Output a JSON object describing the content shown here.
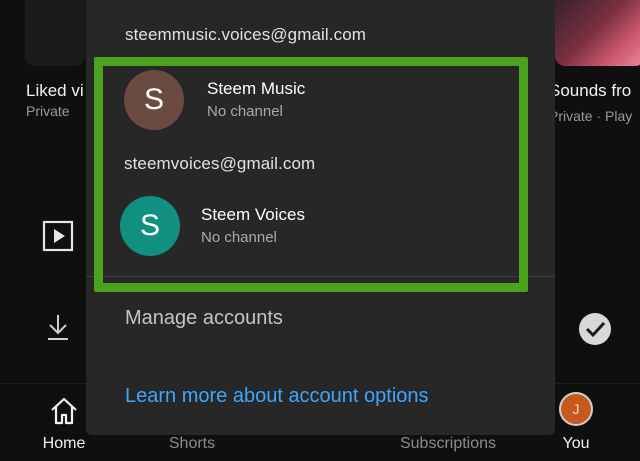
{
  "background": {
    "left_card": {
      "title": "Liked vi",
      "subtitle": "Private"
    },
    "right_card": {
      "title": "Sounds fro",
      "subtitle": "Private · Play"
    }
  },
  "account_sheet": {
    "accounts": [
      {
        "email": "steemmusic.voices@gmail.com",
        "initial": "S",
        "name": "Steem Music",
        "status": "No channel",
        "avatar_color": "#6b4a42"
      },
      {
        "email": "steemvoices@gmail.com",
        "initial": "S",
        "name": "Steem Voices",
        "status": "No channel",
        "avatar_color": "#118f80"
      }
    ],
    "manage_label": "Manage accounts",
    "learn_more_label": "Learn more about account options",
    "highlight_color": "#4aa31a"
  },
  "bottom_nav": {
    "items": [
      {
        "label": "Home",
        "icon": "home-icon"
      },
      {
        "label": "Shorts",
        "icon": "shorts-icon"
      },
      {
        "label": "Subscriptions",
        "icon": "subscriptions-icon"
      },
      {
        "label": "You",
        "icon": "avatar",
        "initial": "J"
      }
    ]
  }
}
